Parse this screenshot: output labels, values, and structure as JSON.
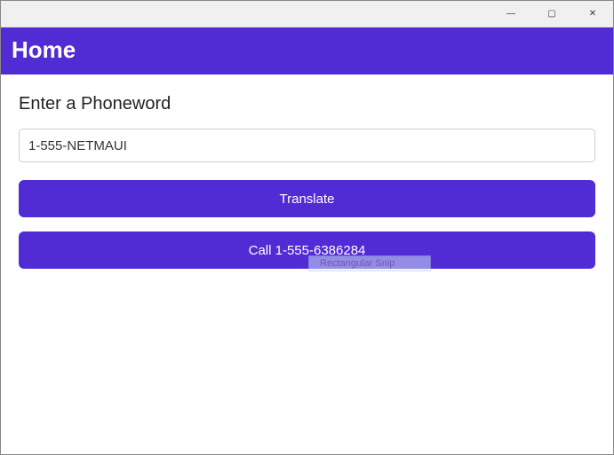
{
  "window": {
    "minimize_glyph": "—",
    "maximize_glyph": "▢",
    "close_glyph": "✕"
  },
  "appbar": {
    "title": "Home"
  },
  "main": {
    "prompt_label": "Enter a Phoneword",
    "phoneword_value": "1-555-NETMAUI",
    "translate_label": "Translate",
    "call_label": "Call 1-555-6386284"
  },
  "overlay": {
    "snip_mode": "Rectangular Snip"
  },
  "colors": {
    "accent": "#512bd4"
  }
}
